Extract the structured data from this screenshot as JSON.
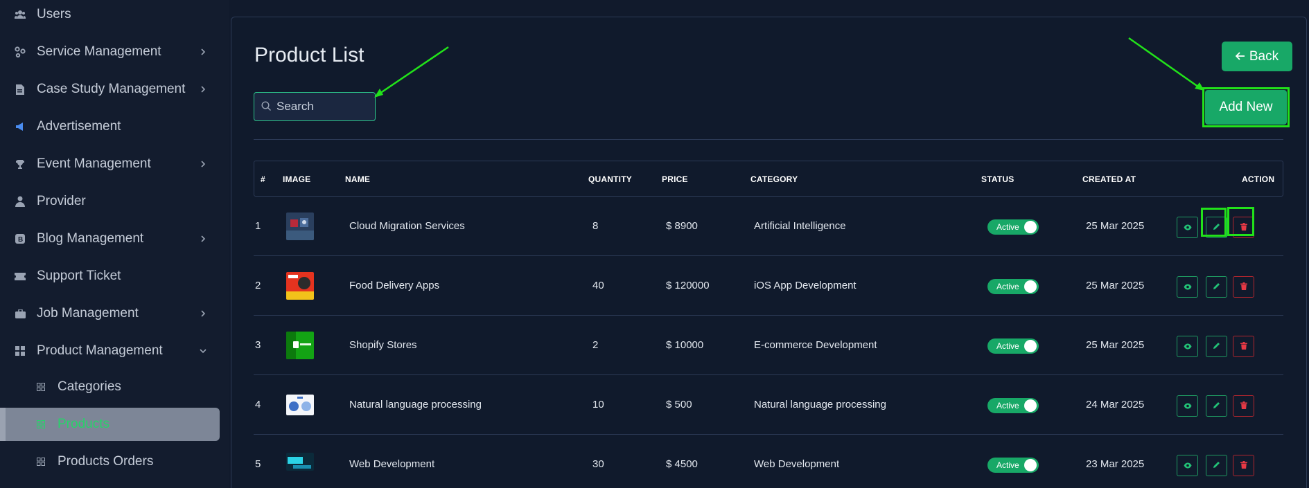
{
  "sidebar": {
    "items": [
      {
        "label": "Users",
        "icon": "users-icon",
        "has_chevron": false
      },
      {
        "label": "Service Management",
        "icon": "services-icon",
        "has_chevron": true
      },
      {
        "label": "Case Study Management",
        "icon": "document-icon",
        "has_chevron": true
      },
      {
        "label": "Advertisement",
        "icon": "megaphone-icon",
        "has_chevron": false
      },
      {
        "label": "Event Management",
        "icon": "trophy-icon",
        "has_chevron": true
      },
      {
        "label": "Provider",
        "icon": "user-tie-icon",
        "has_chevron": false
      },
      {
        "label": "Blog Management",
        "icon": "blog-icon",
        "has_chevron": true
      },
      {
        "label": "Support Ticket",
        "icon": "ticket-icon",
        "has_chevron": false
      },
      {
        "label": "Job Management",
        "icon": "briefcase-icon",
        "has_chevron": true
      },
      {
        "label": "Product Management",
        "icon": "grid-icon",
        "has_chevron": true,
        "expanded": true
      }
    ],
    "sub_items": [
      {
        "label": "Categories",
        "icon": "grid-small-icon"
      },
      {
        "label": "Products",
        "icon": "grid-small-icon",
        "active": true
      },
      {
        "label": "Products Orders",
        "icon": "grid-small-icon"
      }
    ]
  },
  "main": {
    "title": "Product List",
    "back_label": "Back",
    "search_placeholder": "Search",
    "add_new_label": "Add New"
  },
  "table": {
    "headers": {
      "index": "#",
      "image": "IMAGE",
      "name": "NAME",
      "quantity": "QUANTITY",
      "price": "PRICE",
      "category": "CATEGORY",
      "status": "STATUS",
      "created_at": "CREATED AT",
      "action": "ACTION"
    },
    "rows": [
      {
        "index": "1",
        "name": "Cloud Migration Services",
        "quantity": "8",
        "price": "$ 8900",
        "category": "Artificial Intelligence",
        "status": "Active",
        "created_at": "25 Mar 2025"
      },
      {
        "index": "2",
        "name": "Food Delivery Apps",
        "quantity": "40",
        "price": "$ 120000",
        "category": "iOS App Development",
        "status": "Active",
        "created_at": "25 Mar 2025"
      },
      {
        "index": "3",
        "name": "Shopify Stores",
        "quantity": "2",
        "price": "$ 10000",
        "category": "E-commerce Development",
        "status": "Active",
        "created_at": "25 Mar 2025"
      },
      {
        "index": "4",
        "name": "Natural language processing",
        "quantity": "10",
        "price": "$ 500",
        "category": "Natural language processing",
        "status": "Active",
        "created_at": "24 Mar 2025"
      },
      {
        "index": "5",
        "name": "Web Development",
        "quantity": "30",
        "price": "$ 4500",
        "category": "Web Development",
        "status": "Active",
        "created_at": "23 Mar 2025"
      }
    ]
  },
  "colors": {
    "accent": "#18a867",
    "danger": "#b3262e",
    "annotation": "#22e21a",
    "background": "#111a2c"
  }
}
